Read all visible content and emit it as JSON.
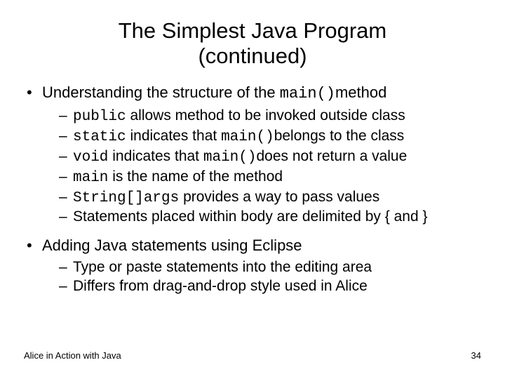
{
  "title_line1": "The Simplest Java Program",
  "title_line2": "(continued)",
  "b1": {
    "pre": "Understanding the structure of the ",
    "code": "main()",
    "post": "method",
    "subs": [
      {
        "code": "public",
        "pre": " ",
        "txt": "allows method to be invoked outside class"
      },
      {
        "code": "static",
        "pre": " ",
        "txt1": "indicates that ",
        "code2": "main()",
        "txt2": "belongs to the class"
      },
      {
        "code": "void",
        "pre": " ",
        "txt1": "indicates that ",
        "code2": "main()",
        "txt2": "does not return a value"
      },
      {
        "code": "main",
        "pre": " ",
        "txt": "is the name of the method"
      },
      {
        "code": "String[]args",
        "pre": " ",
        "txt": "provides a way to pass values"
      },
      {
        "txt": "Statements placed within body are delimited by { and }"
      }
    ]
  },
  "b2": {
    "txt": "Adding Java statements using Eclipse",
    "subs": [
      {
        "txt": "Type or paste statements into the editing area"
      },
      {
        "txt": "Differs from drag-and-drop style used in Alice"
      }
    ]
  },
  "footer_left": "Alice in Action with Java",
  "footer_right": "34"
}
